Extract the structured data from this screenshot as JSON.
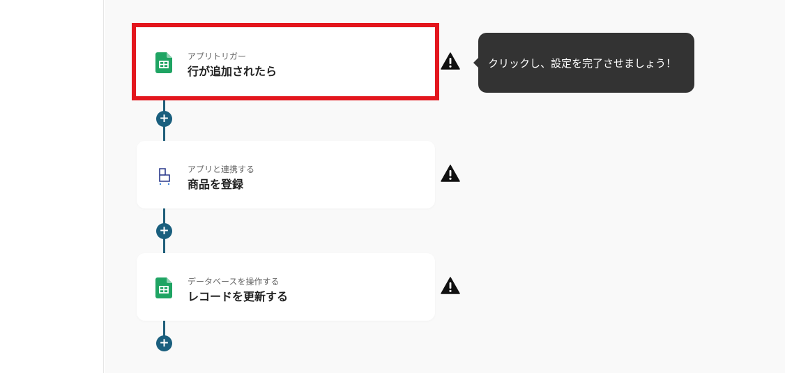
{
  "flow": {
    "steps": [
      {
        "subtitle": "アプリトリガー",
        "title": "行が追加されたら",
        "icon": "google-sheets-icon",
        "highlighted": true
      },
      {
        "subtitle": "アプリと連携する",
        "title": "商品を登録",
        "icon": "shopify-like-app-icon",
        "highlighted": false
      },
      {
        "subtitle": "データベースを操作する",
        "title": "レコードを更新する",
        "icon": "google-sheets-icon",
        "highlighted": false
      }
    ],
    "add_step_label": "+",
    "warning_icon": "warning-icon"
  },
  "tooltip": {
    "text": "クリックし、設定を完了させましょう！"
  },
  "colors": {
    "highlight": "#e3161d",
    "connector": "#1a5f7e",
    "sheets_green": "#1fa463",
    "tooltip_bg": "#333333",
    "canvas_bg": "#f9f9f9"
  }
}
